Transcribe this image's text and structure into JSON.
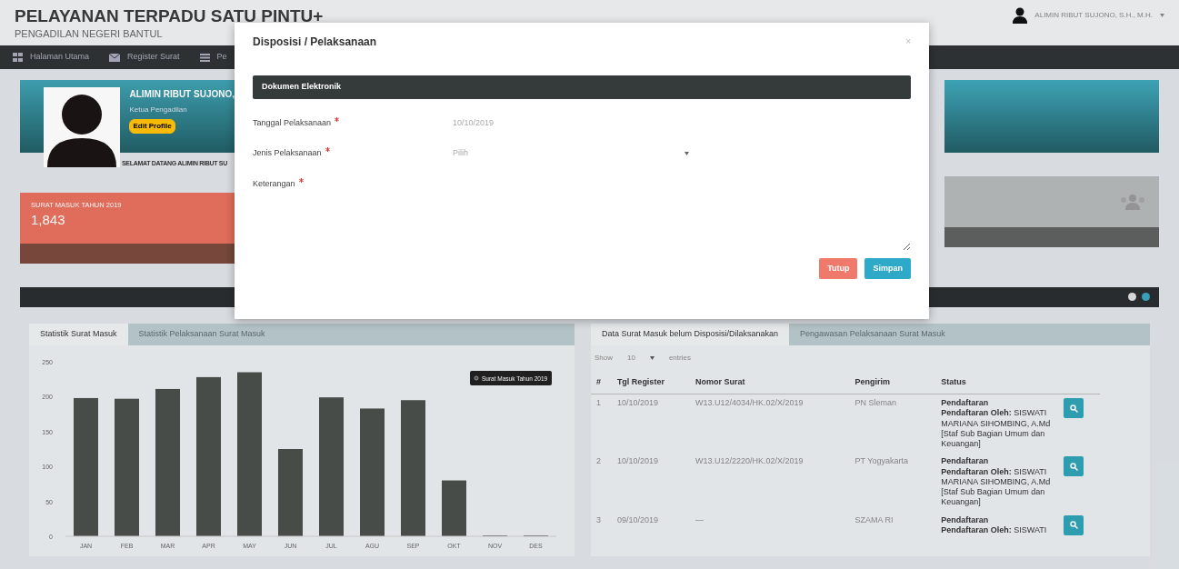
{
  "header": {
    "title": "PELAYANAN TERPADU SATU PINTU+",
    "subtitle": "PENGADILAN NEGERI BANTUL",
    "user": "ALIMIN RIBUT SUJONO, S.H., M.H."
  },
  "nav": [
    {
      "label": "Halaman Utama"
    },
    {
      "label": "Register Surat"
    },
    {
      "label": "Pe"
    }
  ],
  "profile": {
    "name": "ALIMIN RIBUT SUJONO,",
    "role": "Ketua Pengadilan",
    "edit_button": "Edit Profile",
    "welcome": "SELAMAT DATANG ALIMIN RIBUT SU"
  },
  "stat_card": {
    "label": "SURAT MASUK TAHUN 2019",
    "value": "1,843"
  },
  "chart_panel": {
    "tabs": [
      {
        "label": "Statistik Surat Masuk",
        "selected": true
      },
      {
        "label": "Statistik Pelaksanaan Surat Masuk",
        "selected": false
      }
    ],
    "chart_data": {
      "type": "bar",
      "categories": [
        "JAN",
        "FEB",
        "MAR",
        "APR",
        "MAY",
        "JUN",
        "JUL",
        "AGU",
        "SEP",
        "OKT",
        "NOV",
        "DES"
      ],
      "series": [
        {
          "name": "Surat Masuk Tahun 2019",
          "color": "#4a4f4c",
          "values": [
            198,
            197,
            211,
            228,
            235,
            125,
            199,
            183,
            195,
            80,
            0,
            0
          ]
        }
      ],
      "ylim": [
        0,
        250
      ],
      "yticks": [
        0,
        50,
        100,
        150,
        200,
        250
      ]
    }
  },
  "table_panel": {
    "tabs": [
      {
        "label": "Data Surat Masuk belum Disposisi/Dilaksanakan",
        "selected": true
      },
      {
        "label": "Pengawasan Pelaksanaan Surat Masuk",
        "selected": false
      }
    ],
    "length_menu": {
      "prefix": "Show",
      "value": "10",
      "suffix": "entries"
    },
    "columns": [
      "#",
      "Tgl Register",
      "Nomor Surat",
      "Pengirim",
      "Status"
    ],
    "rows": [
      {
        "no": "1",
        "date": "10/10/2019",
        "number": "W13.U12/4034/HK.02/X/2019",
        "sender": "PN Sleman",
        "status": "Pendaftaran",
        "detail": "**Pendaftaran Oleh:** SISWATI MARIANA SIHOMBING, A.Md [Staf Sub Bagian Umum dan Keuangan]"
      },
      {
        "no": "2",
        "date": "10/10/2019",
        "number": "W13.U12/2220/HK.02/X/2019",
        "sender": "PT Yogyakarta",
        "status": "Pendaftaran",
        "detail": "**Pendaftaran Oleh:** SISWATI MARIANA SIHOMBING, A.Md [Staf Sub Bagian Umum dan Keuangan]"
      },
      {
        "no": "3",
        "date": "09/10/2019",
        "number": "—",
        "sender": "SZAMA RI",
        "status": "Pendaftaran",
        "detail": "**Pendaftaran Oleh:** SISWATI"
      }
    ]
  },
  "modal": {
    "title": "Disposisi / Pelaksanaan",
    "close": "×",
    "section": "Dokumen Elektronik",
    "fields": [
      {
        "kind": "input",
        "label": "Tanggal Pelaksanaan",
        "required": true,
        "value": "10/10/2019"
      },
      {
        "kind": "select",
        "label": "Jenis Pelaksanaan",
        "required": true,
        "value": "Pilih"
      },
      {
        "kind": "textarea",
        "label": "Keterangan",
        "required": true
      }
    ],
    "buttons": [
      {
        "label": "Tutup",
        "kind": "danger"
      },
      {
        "label": "Simpan",
        "kind": "info"
      }
    ]
  }
}
